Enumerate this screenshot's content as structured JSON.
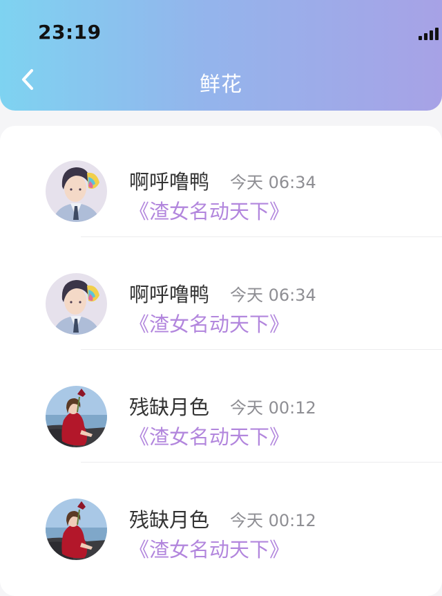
{
  "status_bar": {
    "time": "23:19"
  },
  "nav": {
    "back_icon": "chevron-left-icon",
    "title": "鲜花"
  },
  "colors": {
    "header_gradient": [
      "#7ed3f1",
      "#93b5ec",
      "#a7a2e6"
    ],
    "book_title": "#b286dd",
    "time_text": "#8e8e93"
  },
  "list": [
    {
      "name": "啊呼噜鸭",
      "time": "今天 06:34",
      "book": "《渣女名动天下》",
      "avatar": "anime-boy"
    },
    {
      "name": "啊呼噜鸭",
      "time": "今天 06:34",
      "book": "《渣女名动天下》",
      "avatar": "anime-boy"
    },
    {
      "name": "残缺月色",
      "time": "今天 00:12",
      "book": "《渣女名动天下》",
      "avatar": "girl-seaside"
    },
    {
      "name": "残缺月色",
      "time": "今天 00:12",
      "book": "《渣女名动天下》",
      "avatar": "girl-seaside"
    }
  ]
}
